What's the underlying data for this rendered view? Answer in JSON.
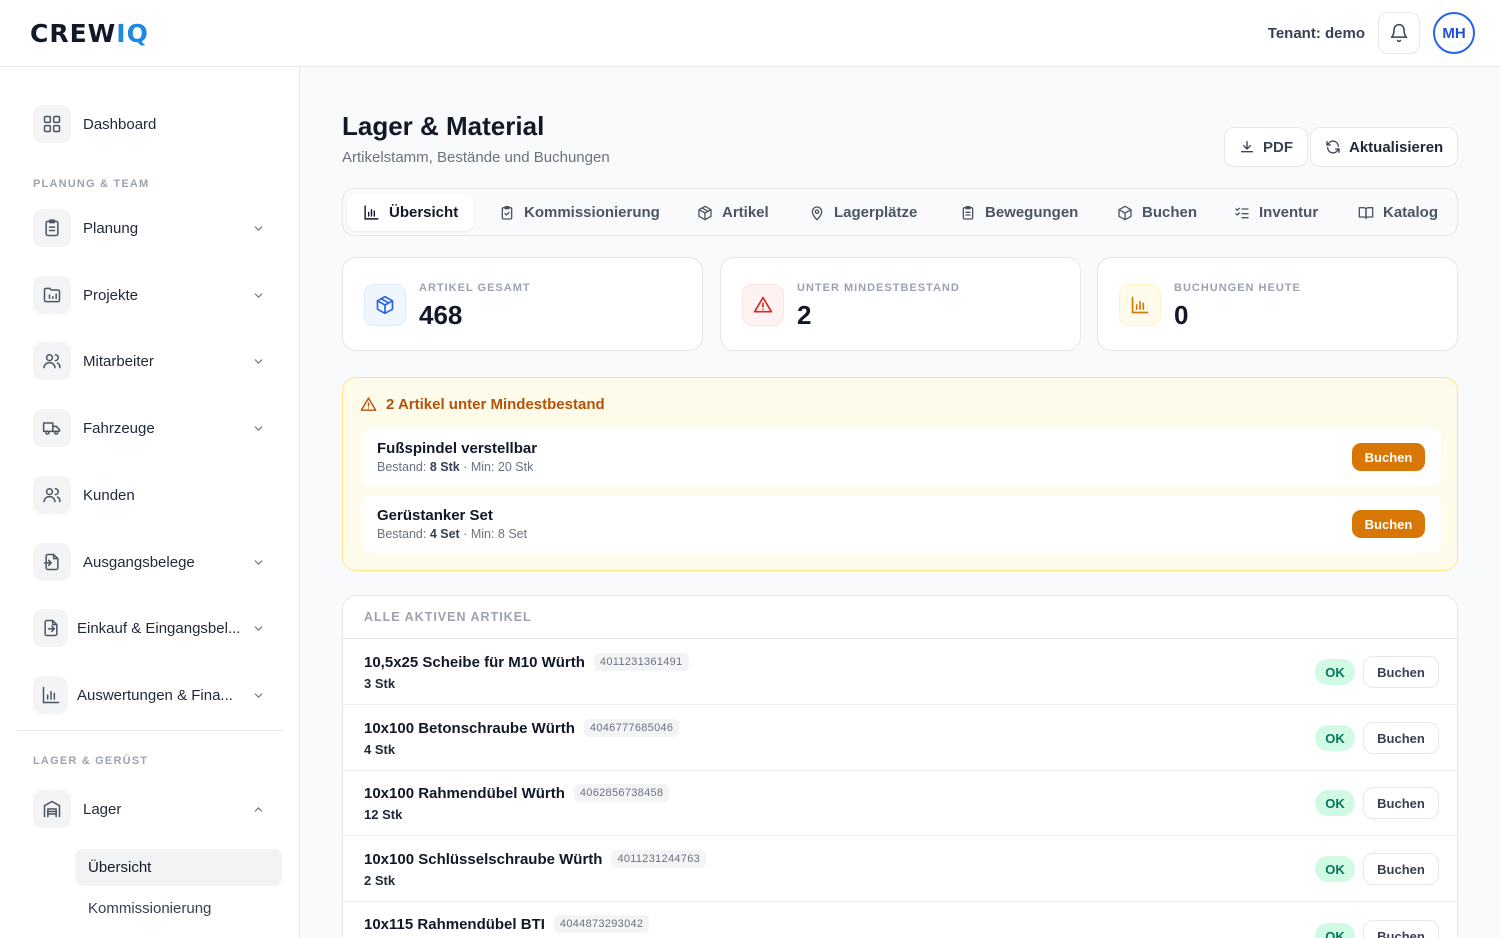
{
  "header": {
    "logo_text": "CREW",
    "logo_accent": "IQ",
    "tenant": "Tenant: demo",
    "avatar_initials": "MH"
  },
  "sidebar": {
    "dashboard": "Dashboard",
    "section_planung": "PLANUNG & TEAM",
    "items": [
      {
        "label": "Planung",
        "icon": "clipboard-icon",
        "expandable": true
      },
      {
        "label": "Projekte",
        "icon": "folder-chart-icon",
        "expandable": true
      },
      {
        "label": "Mitarbeiter",
        "icon": "users-icon",
        "expandable": true
      },
      {
        "label": "Fahrzeuge",
        "icon": "truck-icon",
        "expandable": true
      },
      {
        "label": "Kunden",
        "icon": "users-icon",
        "expandable": false
      },
      {
        "label": "Ausgangsbelege",
        "icon": "file-export-icon",
        "expandable": true
      },
      {
        "label": "Einkauf & Eingangsbel...",
        "icon": "file-import-icon",
        "expandable": true
      },
      {
        "label": "Auswertungen & Fina...",
        "icon": "bar-chart-icon",
        "expandable": true
      }
    ],
    "section_lager": "LAGER & GERÜST",
    "lager": "Lager",
    "sub_items": [
      "Übersicht",
      "Kommissionierung"
    ]
  },
  "page": {
    "title": "Lager & Material",
    "subtitle": "Artikelstamm, Bestände und Buchungen",
    "pdf_label": "PDF",
    "refresh_label": "Aktualisieren"
  },
  "tabs": [
    "Übersicht",
    "Kommissionierung",
    "Artikel",
    "Lagerplätze",
    "Bewegungen",
    "Buchen",
    "Inventur",
    "Katalog"
  ],
  "kpis": [
    {
      "label": "ARTIKEL GESAMT",
      "value": "468",
      "color": "#3b82f6"
    },
    {
      "label": "UNTER MINDESTBESTAND",
      "value": "2",
      "color": "#dc2626"
    },
    {
      "label": "BUCHUNGEN HEUTE",
      "value": "0",
      "color": "#d97706"
    }
  ],
  "alert": {
    "title": "2 Artikel unter Mindestbestand",
    "items": [
      {
        "name": "Fußspindel verstellbar",
        "stock_prefix": "Bestand: ",
        "stock": "8 Stk",
        "min": " · Min: 20 Stk",
        "action": "Buchen"
      },
      {
        "name": "Gerüstanker Set",
        "stock_prefix": "Bestand: ",
        "stock": "4 Set",
        "min": " · Min: 8 Set",
        "action": "Buchen"
      }
    ]
  },
  "list": {
    "title": "ALLE AKTIVEN ARTIKEL",
    "rows": [
      {
        "name": "10,5x25 Scheibe für M10 Würth",
        "ean": "4011231361491",
        "qty": "3 Stk",
        "status": "OK",
        "action": "Buchen"
      },
      {
        "name": "10x100 Betonschraube Würth",
        "ean": "4046777685046",
        "qty": "4 Stk",
        "status": "OK",
        "action": "Buchen"
      },
      {
        "name": "10x100 Rahmendübel Würth",
        "ean": "4062856738458",
        "qty": "12 Stk",
        "status": "OK",
        "action": "Buchen"
      },
      {
        "name": "10x100 Schlüsselschraube Würth",
        "ean": "4011231244763",
        "qty": "2 Stk",
        "status": "OK",
        "action": "Buchen"
      },
      {
        "name": "10x115 Rahmendübel BTI",
        "ean": "4044873293042",
        "qty": "",
        "status": "OK",
        "action": "Buchen"
      }
    ]
  }
}
